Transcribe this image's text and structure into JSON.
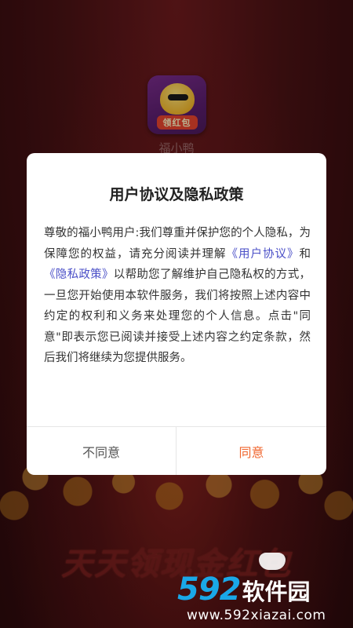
{
  "app": {
    "icon_banner": "领红包",
    "name": "福小鸭"
  },
  "background": {
    "slogan": "天天领现金红包"
  },
  "dialog": {
    "title": "用户协议及隐私政策",
    "body": {
      "part1": "尊敬的福小鸭用户:我们尊重并保护您的个人隐私，为保障您的权益，请充分阅读并理解",
      "link_user_agreement": "《用户协议》",
      "and": "和",
      "link_privacy_policy": "《隐私政策》",
      "part2": "以帮助您了解维护自己隐私权的方式，一旦您开始使用本软件服务，我们将按照上述内容中约定的权利和义务来处理您的个人信息。点击\"同意\"即表示您已阅读并接受上述内容之约定条款，然后我们将继续为您提供服务。"
    },
    "buttons": {
      "disagree": "不同意",
      "agree": "同意"
    }
  },
  "watermark": {
    "number": "592",
    "name": "软件园",
    "url": "www.592xiazai.com"
  },
  "colors": {
    "accent_orange": "#f0662e",
    "link_blue": "#4a4fc7",
    "watermark_blue": "#1aa8e8"
  }
}
